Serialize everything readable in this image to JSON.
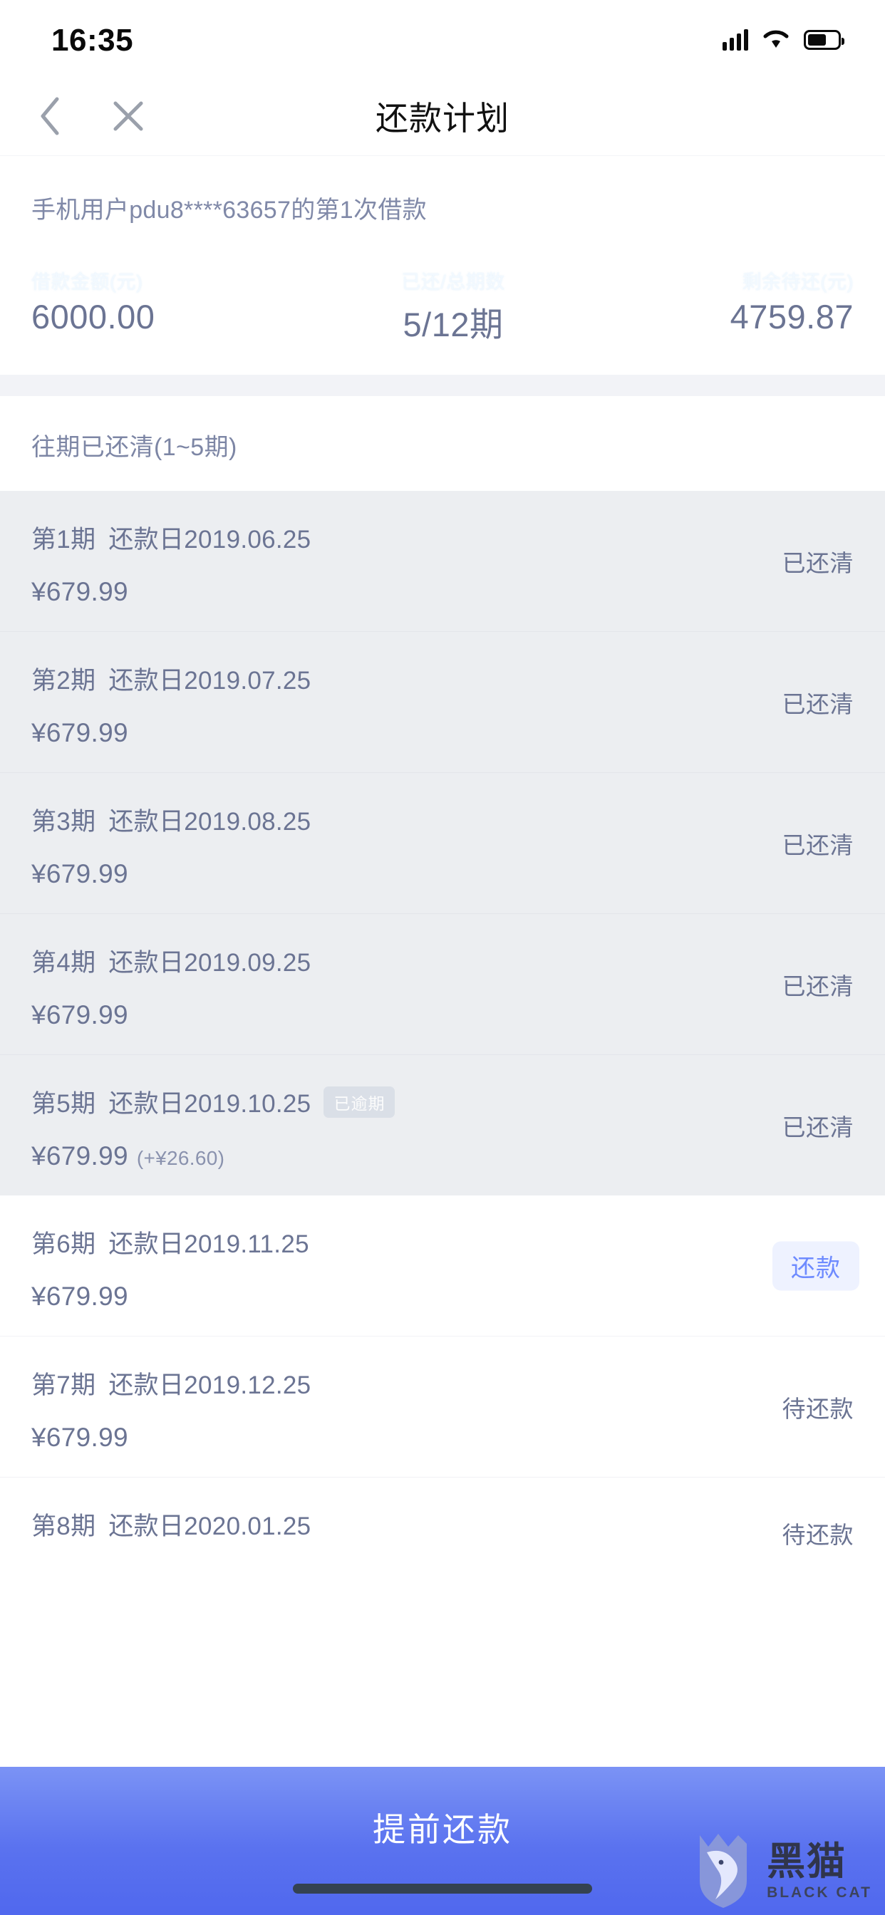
{
  "status_bar": {
    "time": "16:35",
    "signal_icon": "cellular-signal-icon",
    "wifi_icon": "wifi-icon",
    "battery_icon": "battery-icon"
  },
  "nav": {
    "back_icon": "chevron-left-icon",
    "close_icon": "close-icon",
    "title": "还款计划"
  },
  "summary": {
    "user_line": "手机用户pdu8****63657的第1次借款",
    "columns": [
      {
        "label": "借款金额(元)",
        "value": "6000.00"
      },
      {
        "label": "已还/总期数",
        "value": "5/12期"
      },
      {
        "label": "剩余待还(元)",
        "value": "4759.87"
      }
    ]
  },
  "section": {
    "paid_header": "往期已还清(1~5期)"
  },
  "installments_paid": [
    {
      "period": "第1期",
      "date": "还款日2019.06.25",
      "amount": "¥679.99",
      "extra": "",
      "overdue_badge": "",
      "status": "已还清"
    },
    {
      "period": "第2期",
      "date": "还款日2019.07.25",
      "amount": "¥679.99",
      "extra": "",
      "overdue_badge": "",
      "status": "已还清"
    },
    {
      "period": "第3期",
      "date": "还款日2019.08.25",
      "amount": "¥679.99",
      "extra": "",
      "overdue_badge": "",
      "status": "已还清"
    },
    {
      "period": "第4期",
      "date": "还款日2019.09.25",
      "amount": "¥679.99",
      "extra": "",
      "overdue_badge": "",
      "status": "已还清"
    },
    {
      "period": "第5期",
      "date": "还款日2019.10.25",
      "amount": "¥679.99",
      "extra": "(+¥26.60)",
      "overdue_badge": "已逾期",
      "status": "已还清"
    }
  ],
  "installments_due": [
    {
      "period": "第6期",
      "date": "还款日2019.11.25",
      "amount": "¥679.99",
      "action_label": "还款",
      "status": ""
    },
    {
      "period": "第7期",
      "date": "还款日2019.12.25",
      "amount": "¥679.99",
      "action_label": "",
      "status": "待还款"
    },
    {
      "period": "第8期",
      "date": "还款日2020.01.25",
      "amount": "",
      "action_label": "",
      "status": "待还款"
    }
  ],
  "bottom_bar": {
    "primary_action": "提前还款"
  },
  "watermark": {
    "cn": "黑猫",
    "en": "BLACK CAT",
    "icon": "black-cat-shield-icon"
  },
  "colors": {
    "accent": "#5a72ef",
    "link": "#6e8bff",
    "text": "#6b7493",
    "paid_bg": "#eceef1"
  }
}
